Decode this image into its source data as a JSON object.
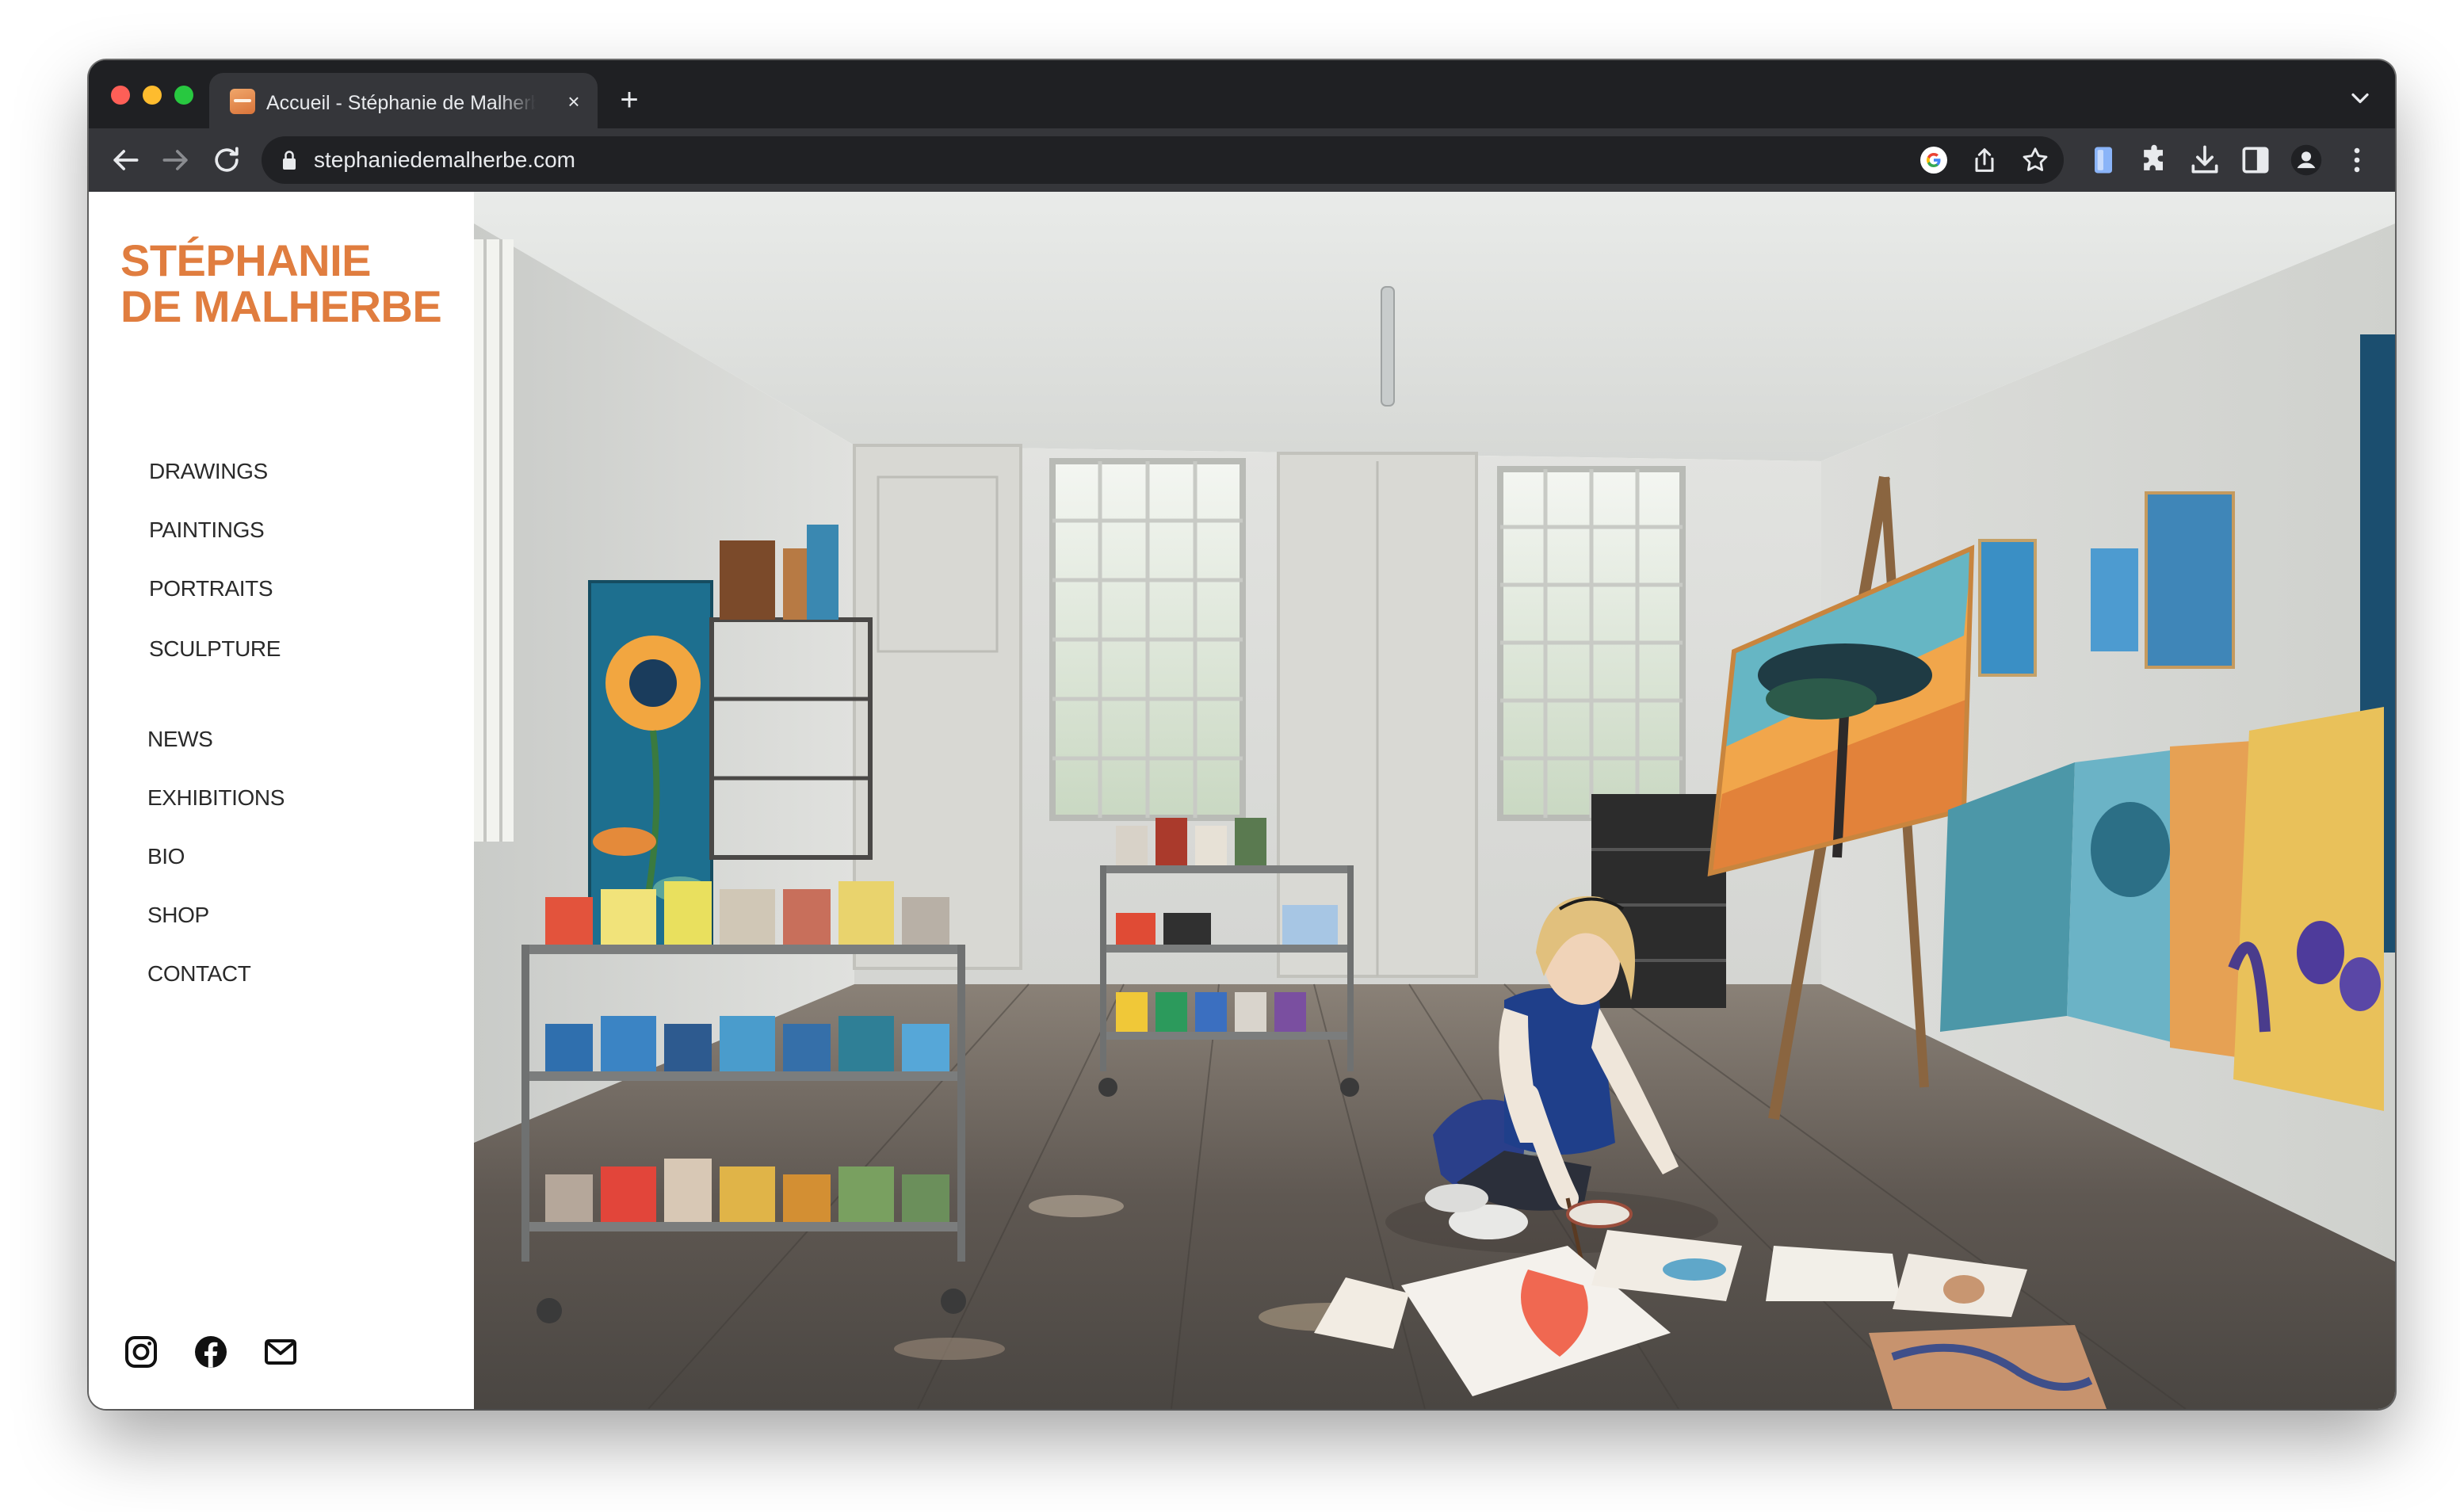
{
  "browser": {
    "tab_title": "Accueil - Stéphanie de Malherbe",
    "tab_close_label": "×",
    "new_tab_label": "+",
    "url": "stephaniedemalherbe.com"
  },
  "site": {
    "logo_line1": "STÉPHANIE",
    "logo_line2": "DE MALHERBE",
    "menu_primary": [
      {
        "label": "DRAWINGS"
      },
      {
        "label": "PAINTINGS"
      },
      {
        "label": "PORTRAITS"
      },
      {
        "label": "SCULPTURE"
      }
    ],
    "menu_secondary": [
      {
        "label": "NEWS"
      },
      {
        "label": "EXHIBITIONS"
      },
      {
        "label": "BIO"
      },
      {
        "label": "SHOP"
      },
      {
        "label": "CONTACT"
      }
    ],
    "social": [
      "instagram-icon",
      "facebook-icon",
      "mail-icon"
    ]
  },
  "colors": {
    "brand": "#e07d3f",
    "menu_text": "#2a2a2a",
    "browser_frame": "#1f2023",
    "browser_toolbar": "#35363a"
  }
}
